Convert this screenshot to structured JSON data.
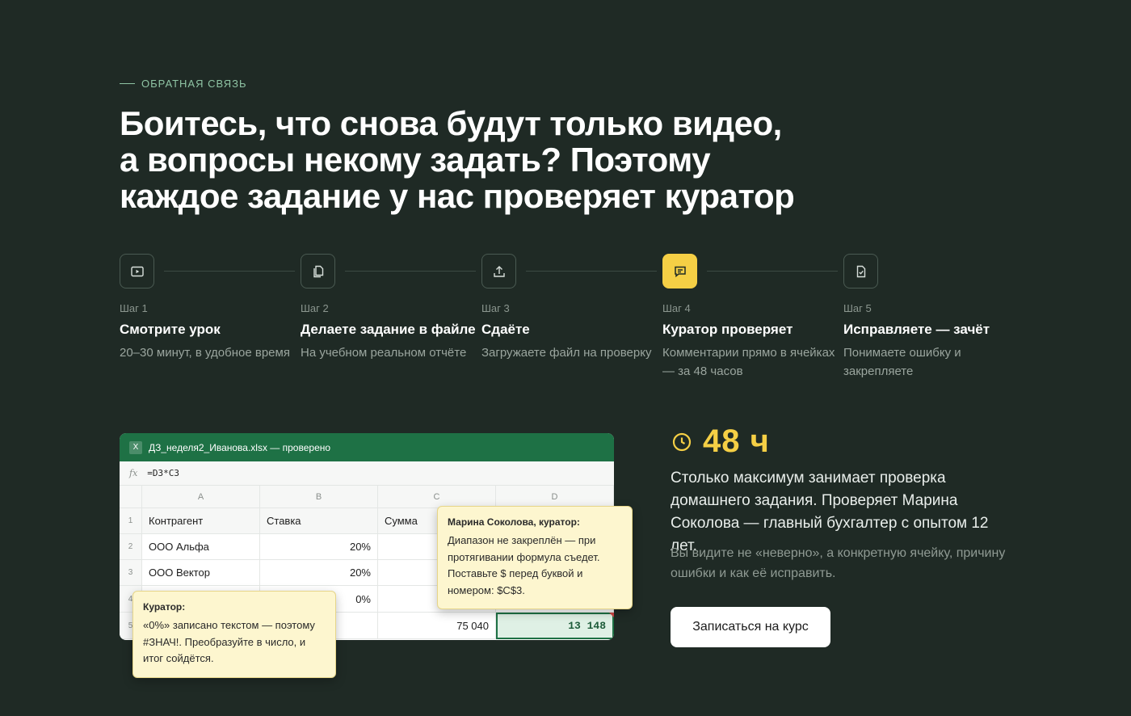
{
  "section": {
    "eyebrow": "ОБРАТНАЯ СВЯЗЬ",
    "headline": [
      "Боитесь, что снова будут только видео,",
      "а вопросы некому задать? Поэтому",
      "каждое задание у нас проверяет куратор"
    ]
  },
  "steps": [
    {
      "num": "Шаг 1",
      "title": "Смотрите урок",
      "desc": "20–30 минут, в удобное время",
      "icon": "play-icon"
    },
    {
      "num": "Шаг 2",
      "title": "Делаете задание в файле",
      "desc": "На учебном реальном отчёте",
      "icon": "file-icon"
    },
    {
      "num": "Шаг 3",
      "title": "Сдаёте",
      "desc": "Загружаете файл на проверку",
      "icon": "upload-icon"
    },
    {
      "num": "Шаг 4",
      "title": "Куратор проверяет",
      "desc": "Комментарии прямо в ячейках — за 48 часов",
      "icon": "comment-icon",
      "active": true
    },
    {
      "num": "Шаг 5",
      "title": "Исправляете — зачёт",
      "desc": "Понимаете ошибку и закрепляете",
      "icon": "file-check-icon"
    }
  ],
  "sheet": {
    "app_badge": "X",
    "filename": "ДЗ_неделя2_Иванова.xlsx — проверено",
    "fx_label": "fx",
    "formula": "=D3*C3",
    "columns": [
      "A",
      "B",
      "C",
      "D"
    ],
    "rows": [
      {
        "idx": "1",
        "a": "Контрагент",
        "b": "Ставка",
        "c": "Сумма",
        "d": ""
      },
      {
        "idx": "2",
        "a": "ООО Альфа",
        "b": "20%",
        "c": "",
        "d": ""
      },
      {
        "idx": "3",
        "a": "ООО Вектор",
        "b": "20%",
        "c": "",
        "d": ""
      },
      {
        "idx": "4",
        "a": "",
        "b": "0%",
        "c": "",
        "d": ""
      },
      {
        "idx": "5",
        "a": "",
        "b": "",
        "c": "75 040",
        "d": "13 148"
      }
    ]
  },
  "notes": {
    "curator_named": {
      "title": "Марина Соколова, куратор:",
      "body": "Диапазон не закреплён — при протягивании формула съедет. Поставьте $ перед буквой и номером: $C$3."
    },
    "curator_short": {
      "title": "Куратор:",
      "body": "«0%» записано текстом — поэтому #ЗНАЧ!. Преобразуйте в число, и итог сойдётся."
    }
  },
  "stat": {
    "value": "48 ч",
    "icon": "clock-icon",
    "text": "Столько максимум занимает проверка домашнего задания. Проверяет Марина Соколова — главный бухгалтер с опытом 12 лет.",
    "sub": "Вы видите не «неверно», а конкретную ячейку, причину ошибки и как её исправить."
  },
  "cta": {
    "label": "Записаться на курс"
  },
  "colors": {
    "background": "#1f2a25",
    "accent": "#f5cf45",
    "excel_green": "#1e7145",
    "eyebrow": "#8fc4a4"
  }
}
